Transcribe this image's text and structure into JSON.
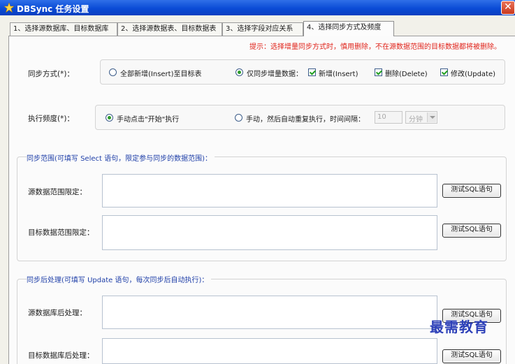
{
  "window": {
    "title": "DBSync 任务设置",
    "close_glyph": "✕",
    "app_icon": "star-app-icon"
  },
  "tabs": [
    {
      "label": "1、选择源数据库、目标数据库"
    },
    {
      "label": "2、选择源数据表、目标数据表"
    },
    {
      "label": "3、选择字段对应关系"
    },
    {
      "label": "4、选择同步方式及频度"
    }
  ],
  "hint": "提示：选择增量同步方式时，慎用删除，不在源数据范围的目标数据都将被删除。",
  "sync_mode": {
    "label": "同步方式(*)：",
    "options": [
      {
        "label": "全部新增(Insert)至目标表",
        "selected": false
      },
      {
        "label": "仅同步增量数据：",
        "selected": true
      }
    ],
    "checks": [
      {
        "label": "新增(Insert)",
        "checked": true
      },
      {
        "label": "删除(Delete)",
        "checked": true
      },
      {
        "label": "修改(Update)",
        "checked": true
      }
    ]
  },
  "frequency": {
    "label": "执行频度(*)：",
    "options": [
      {
        "label": "手动点击\"开始\"执行",
        "selected": true
      },
      {
        "label": "手动，然后自动重复执行，时间间隔：",
        "selected": false
      }
    ],
    "interval_value": "10",
    "interval_unit": "分钟"
  },
  "range_group": {
    "title": "同步范围(可填写 Select 语句，限定参与同步的数据范围)：",
    "source_label": "源数据范围限定：",
    "target_label": "目标数据范围限定：",
    "test_label": "测试SQL语句"
  },
  "post_group": {
    "title": "同步后处理(可填写 Update 语句，每次同步后自动执行)：",
    "source_label": "源数据库后处理：",
    "target_label": "目标数据库后处理：",
    "test_label": "测试SQL语句"
  },
  "watermark": "最需教育",
  "colors": {
    "hint": "#e0241b",
    "group_title": "#1f3fa8",
    "titlebar": "#0a4bd6",
    "check": "#22a022"
  }
}
